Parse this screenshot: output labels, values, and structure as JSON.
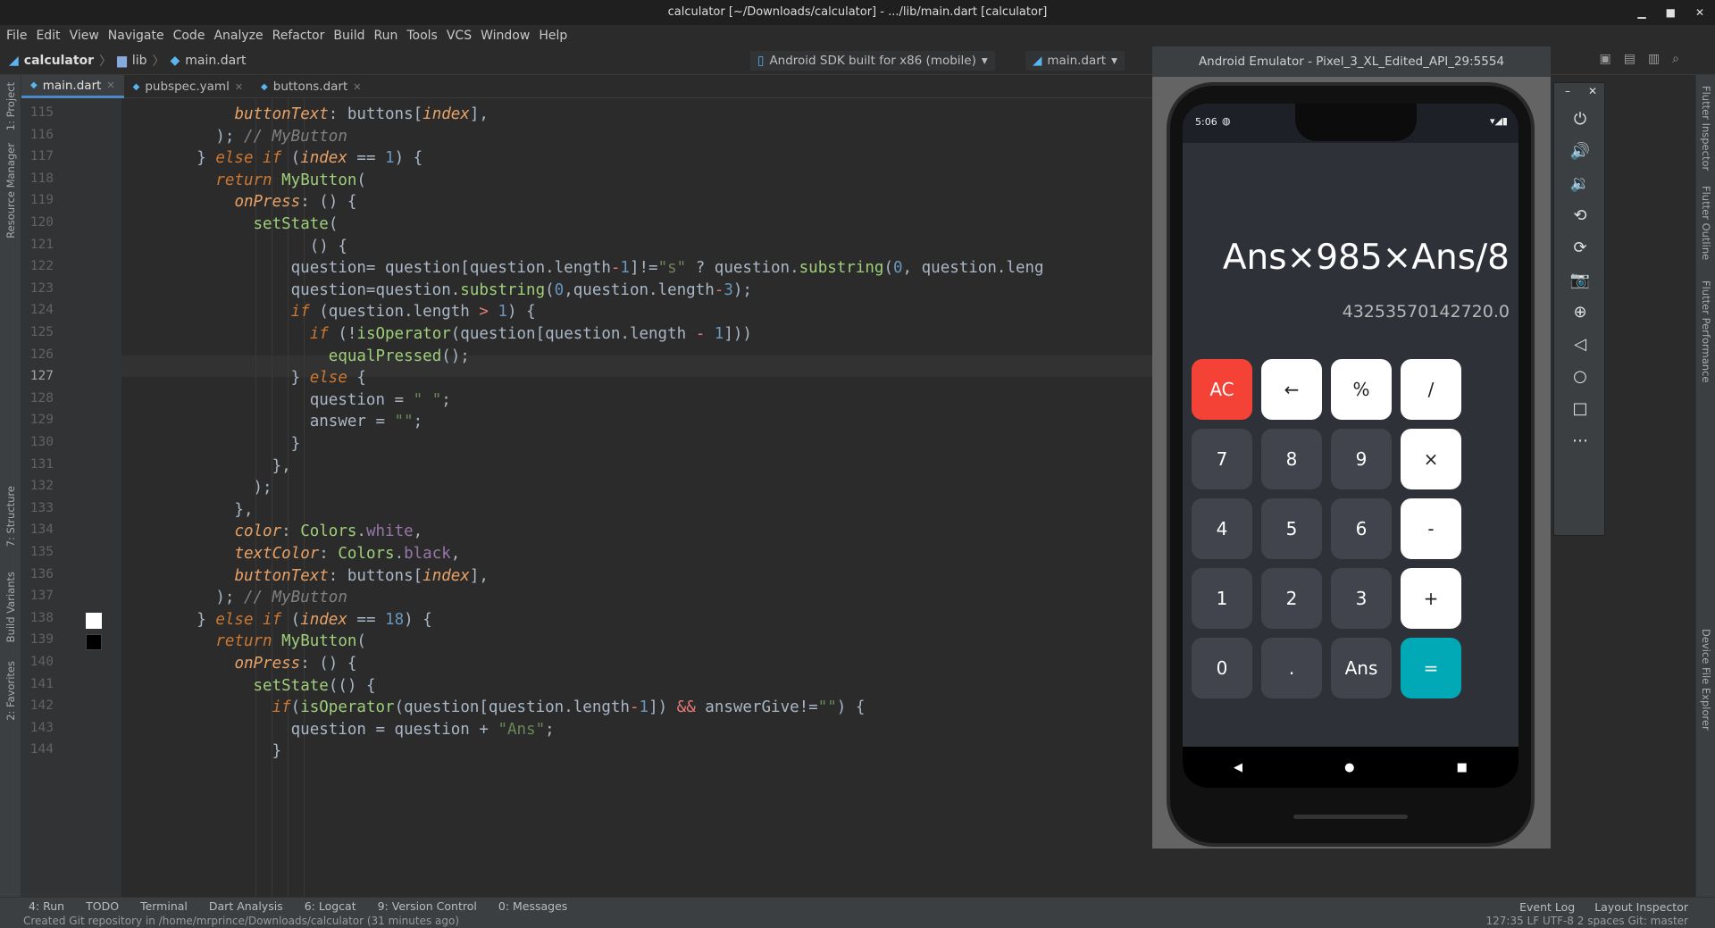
{
  "window": {
    "title": "calculator [~/Downloads/calculator] - .../lib/main.dart [calculator]"
  },
  "menu": [
    "File",
    "Edit",
    "View",
    "Navigate",
    "Code",
    "Analyze",
    "Refactor",
    "Build",
    "Run",
    "Tools",
    "VCS",
    "Window",
    "Help"
  ],
  "breadcrumb": {
    "project": "calculator",
    "folder": "lib",
    "file": "main.dart"
  },
  "toolbar": {
    "device": "Android SDK built for x86 (mobile)",
    "run_config": "main.dart"
  },
  "tabs": [
    {
      "label": "main.dart",
      "active": true
    },
    {
      "label": "pubspec.yaml",
      "active": false
    },
    {
      "label": "buttons.dart",
      "active": false
    }
  ],
  "left_tools": [
    "1: Project",
    "Resource Manager",
    "7: Structure",
    "Build Variants",
    "2: Favorites"
  ],
  "right_tools": [
    "Flutter Inspector",
    "Flutter Outline",
    "Flutter Performance",
    "Device File Explorer"
  ],
  "editor": {
    "current_line": 127,
    "lines": [
      {
        "n": 115,
        "html": "            <span class='prm'>buttonText</span>: buttons[<span class='prm'>index</span>],"
      },
      {
        "n": 116,
        "html": "          ); <span class='cmt'>// MyButton</span>"
      },
      {
        "n": 117,
        "html": "        } <span class='kw'>else if</span> (<span class='prm'>index</span> == <span class='num'>1</span>) {"
      },
      {
        "n": 118,
        "html": "          <span class='kw'>return</span> <span class='cls'>MyButton</span>("
      },
      {
        "n": 119,
        "html": "            <span class='prm'>onPress</span>: () {"
      },
      {
        "n": 120,
        "html": "              <span class='cls'>setState</span>("
      },
      {
        "n": 121,
        "html": "                    () {"
      },
      {
        "n": 122,
        "html": "                  question= question[question.length<span class='op'>-</span><span class='num'>1</span>]!=<span class='str'>\"s\"</span> ? question.<span class='cls'>substring</span>(<span class='num'>0</span>, question.leng"
      },
      {
        "n": 123,
        "html": "                  question=question.<span class='cls'>substring</span>(<span class='num'>0</span>,question.length<span class='op'>-</span><span class='num'>3</span>);"
      },
      {
        "n": 124,
        "html": "                  <span class='kw'>if</span> (question.length <span class='op'>&gt;</span> <span class='num'>1</span>) {"
      },
      {
        "n": 125,
        "html": "                    <span class='kw'>if</span> (!<span class='cls'>isOperator</span>(question[question.length <span class='op'>-</span> <span class='num'>1</span>]))"
      },
      {
        "n": 126,
        "html": "                      <span class='cls'>equalPressed</span>();"
      },
      {
        "n": 127,
        "html": "                  } <span class='kw'>else</span> {"
      },
      {
        "n": 128,
        "html": "                    question = <span class='str'>\" \"</span>;"
      },
      {
        "n": 129,
        "html": "                    answer = <span class='str'>\"\"</span>;"
      },
      {
        "n": 130,
        "html": "                  }"
      },
      {
        "n": 131,
        "html": "                },"
      },
      {
        "n": 132,
        "html": "              );"
      },
      {
        "n": 133,
        "html": "            },"
      },
      {
        "n": 134,
        "html": "            <span class='prm'>color</span>: <span class='cls'>Colors</span>.<span class='fld'>white</span>,"
      },
      {
        "n": 135,
        "html": "            <span class='prm'>textColor</span>: <span class='cls'>Colors</span>.<span class='fld'>black</span>,"
      },
      {
        "n": 136,
        "html": "            <span class='prm'>buttonText</span>: buttons[<span class='prm'>index</span>],"
      },
      {
        "n": 137,
        "html": "          ); <span class='cmt'>// MyButton</span>"
      },
      {
        "n": 138,
        "html": "        } <span class='kw'>else if</span> (<span class='prm'>index</span> == <span class='num'>18</span>) {"
      },
      {
        "n": 139,
        "html": "          <span class='kw'>return</span> <span class='cls'>MyButton</span>("
      },
      {
        "n": 140,
        "html": "            <span class='prm'>onPress</span>: () {"
      },
      {
        "n": 141,
        "html": "              <span class='cls'>setState</span>(() {"
      },
      {
        "n": 142,
        "html": "                <span class='kw'>if</span>(<span class='cls'>isOperator</span>(question[question.length<span class='op'>-</span><span class='num'>1</span>]) <span class='op'>&amp;&amp;</span> answerGive!=<span class='str'>\"\"</span>) {"
      },
      {
        "n": 143,
        "html": "                  question = question + <span class='str'>\"Ans\"</span>;"
      },
      {
        "n": 144,
        "html": "                }"
      }
    ]
  },
  "emulator": {
    "title": "Android Emulator - Pixel_3_XL_Edited_API_29:5554",
    "time": "5:06",
    "question": "Ans×985×Ans/8",
    "answer": "43253570142720.0",
    "keys": [
      {
        "label": "AC",
        "style": "red"
      },
      {
        "label": "←",
        "style": "white"
      },
      {
        "label": "%",
        "style": "white"
      },
      {
        "label": "/",
        "style": "white"
      },
      {
        "label": "7",
        "style": "dark"
      },
      {
        "label": "8",
        "style": "dark"
      },
      {
        "label": "9",
        "style": "dark"
      },
      {
        "label": "×",
        "style": "white"
      },
      {
        "label": "4",
        "style": "dark"
      },
      {
        "label": "5",
        "style": "dark"
      },
      {
        "label": "6",
        "style": "dark"
      },
      {
        "label": "-",
        "style": "white"
      },
      {
        "label": "1",
        "style": "dark"
      },
      {
        "label": "2",
        "style": "dark"
      },
      {
        "label": "3",
        "style": "dark"
      },
      {
        "label": "+",
        "style": "white"
      },
      {
        "label": "0",
        "style": "dark"
      },
      {
        "label": ".",
        "style": "dark"
      },
      {
        "label": "Ans",
        "style": "dark"
      },
      {
        "label": "=",
        "style": "teal"
      }
    ],
    "side_controls": [
      "power-icon",
      "volume-up-icon",
      "volume-down-icon",
      "rotate-left-icon",
      "rotate-right-icon",
      "camera-icon",
      "zoom-icon",
      "back-icon",
      "home-icon",
      "overview-icon",
      "more-icon"
    ]
  },
  "bottom_tools": [
    "4: Run",
    "TODO",
    "Terminal",
    "Dart Analysis",
    "6: Logcat",
    "9: Version Control",
    "0: Messages"
  ],
  "bottom_right": [
    "Event Log",
    "Layout Inspector"
  ],
  "status": {
    "message": "Created Git repository in /home/mrprince/Downloads/calculator (31 minutes ago)",
    "right": "127:35  LF  UTF-8  2 spaces  Git: master"
  },
  "colors": {
    "accent": "#4a88c7",
    "calc_red": "#f44336",
    "calc_teal": "#00a9b5"
  }
}
